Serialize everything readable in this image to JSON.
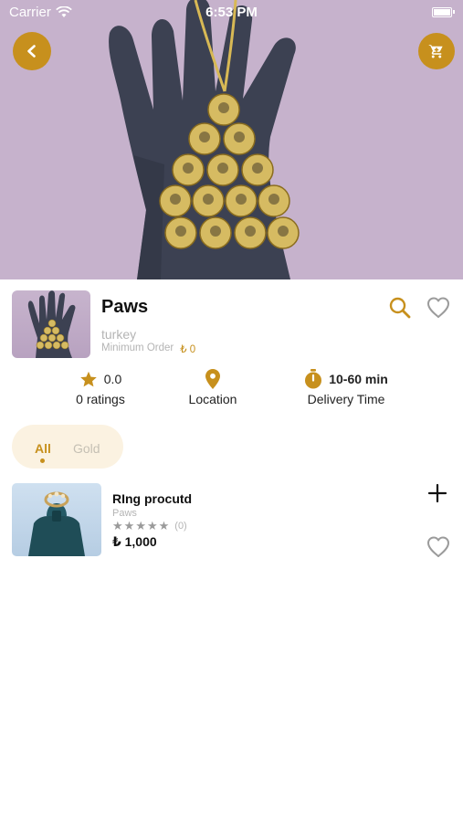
{
  "status_bar": {
    "carrier": "Carrier",
    "time": "6:53 PM"
  },
  "hero": {
    "back_icon": "chevron-left-icon",
    "cart_icon": "cart-icon"
  },
  "store": {
    "name": "Paws",
    "country": "turkey",
    "min_order_label": "Minimum Order",
    "min_order_value": "₺ 0"
  },
  "stats": {
    "rating_value": "0.0",
    "rating_label": "0 ratings",
    "location_label": "Location",
    "delivery_value": "10-60 min",
    "delivery_label": "Delivery Time"
  },
  "tabs": [
    {
      "label": "All",
      "active": true
    },
    {
      "label": "Gold",
      "active": false
    }
  ],
  "products": [
    {
      "name": "RIng procutd",
      "store": "Paws",
      "rating": 0,
      "rating_count": "(0)",
      "price": "₺ 1,000"
    }
  ],
  "colors": {
    "accent": "#c7901d",
    "muted": "#b4b4b4",
    "tab_bg": "#fbf2e1"
  }
}
